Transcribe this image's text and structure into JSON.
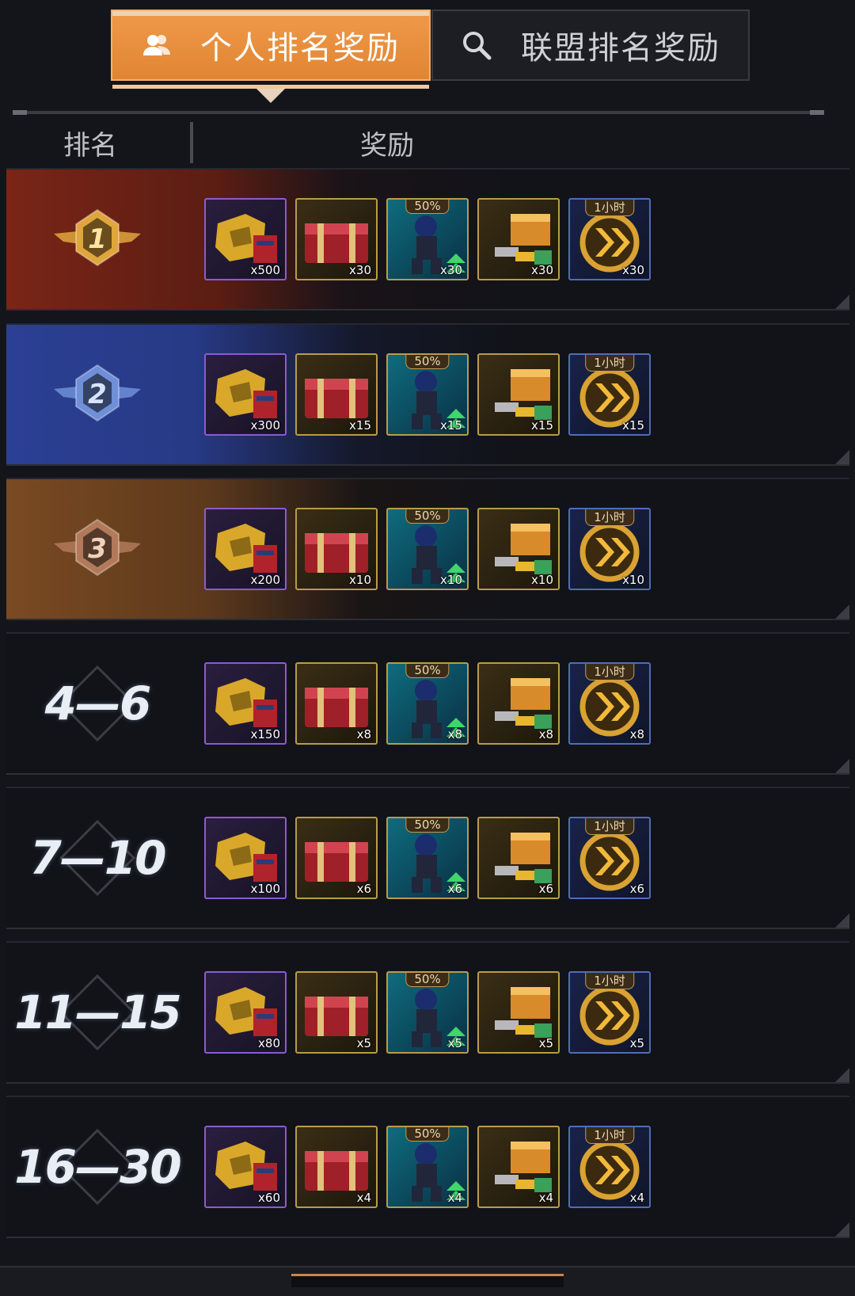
{
  "tabs": {
    "personal": {
      "label": "个人排名奖励",
      "active": true
    },
    "alliance": {
      "label": "联盟排名奖励",
      "active": false
    }
  },
  "table_header": {
    "rank": "排名",
    "reward": "奖励"
  },
  "item_tags": {
    "boost": "50%",
    "speedup": "1小时"
  },
  "colors": {
    "accent": "#e8893a",
    "first": "#7a2516",
    "second": "#2b3f94",
    "third": "#7a4a22"
  },
  "rows": [
    {
      "rank": "1",
      "rank_icon": "gold-medal-1-icon",
      "rewards": [
        "x500",
        "x30",
        "x30",
        "x30",
        "x30"
      ]
    },
    {
      "rank": "2",
      "rank_icon": "silver-medal-2-icon",
      "rewards": [
        "x300",
        "x15",
        "x15",
        "x15",
        "x15"
      ]
    },
    {
      "rank": "3",
      "rank_icon": "bronze-medal-3-icon",
      "rewards": [
        "x200",
        "x10",
        "x10",
        "x10",
        "x10"
      ]
    },
    {
      "rank": "4—6",
      "rewards": [
        "x150",
        "x8",
        "x8",
        "x8",
        "x8"
      ]
    },
    {
      "rank": "7—10",
      "rewards": [
        "x100",
        "x6",
        "x6",
        "x6",
        "x6"
      ]
    },
    {
      "rank": "11—15",
      "rewards": [
        "x80",
        "x5",
        "x5",
        "x5",
        "x5"
      ]
    },
    {
      "rank": "16—30",
      "rewards": [
        "x60",
        "x4",
        "x4",
        "x4",
        "x4"
      ]
    }
  ]
}
